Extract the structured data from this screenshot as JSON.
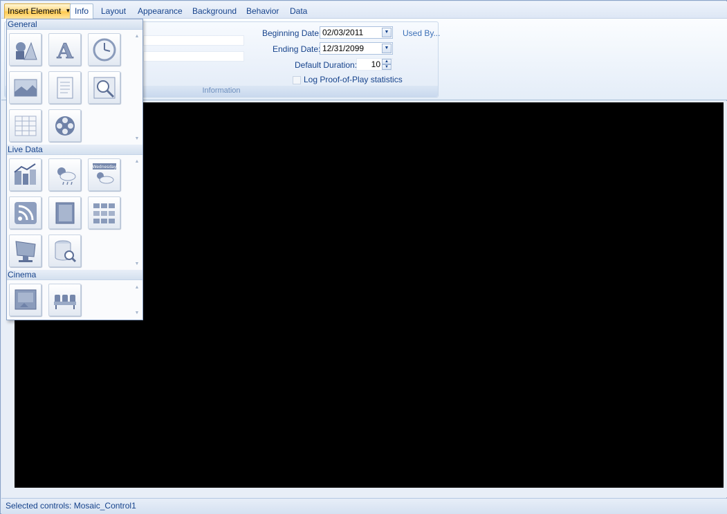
{
  "tabs": [
    {
      "label": "Insert Element"
    },
    {
      "label": "Info"
    },
    {
      "label": "Layout"
    },
    {
      "label": "Appearance"
    },
    {
      "label": "Background"
    },
    {
      "label": "Behavior"
    },
    {
      "label": "Data"
    }
  ],
  "ribbon": {
    "group_caption": "Information",
    "beginning_date_label": "Beginning Date:",
    "beginning_date_value": "02/03/2011",
    "ending_date_label": "Ending Date:",
    "ending_date_value": "12/31/2099",
    "default_duration_label": "Default Duration:",
    "default_duration_value": "10",
    "log_pop_label": "Log Proof-of-Play statistics",
    "log_pop_checked": false,
    "used_by_label": "Used By..."
  },
  "gallery": {
    "sections": [
      {
        "title": "General",
        "items": [
          "shapes-icon",
          "text-icon",
          "clock-icon",
          "image-icon",
          "document-icon",
          "zoom-icon",
          "table-icon",
          "video-icon"
        ]
      },
      {
        "title": "Live Data",
        "items": [
          "stock-ticker-icon",
          "weather-icon",
          "weather-forecast-icon",
          "rss-feed-icon",
          "notebook-icon",
          "data-grid-icon",
          "kiosk-icon",
          "database-search-icon"
        ]
      },
      {
        "title": "Cinema",
        "items": [
          "movie-poster-icon",
          "theater-seats-icon"
        ]
      }
    ],
    "forecast_label": "Wednesday"
  },
  "status": {
    "text": "Selected controls: Mosaic_Control1"
  },
  "colors": {
    "accent": "#15428b",
    "tab_active": "#ffc94a",
    "canvas": "#000000"
  }
}
